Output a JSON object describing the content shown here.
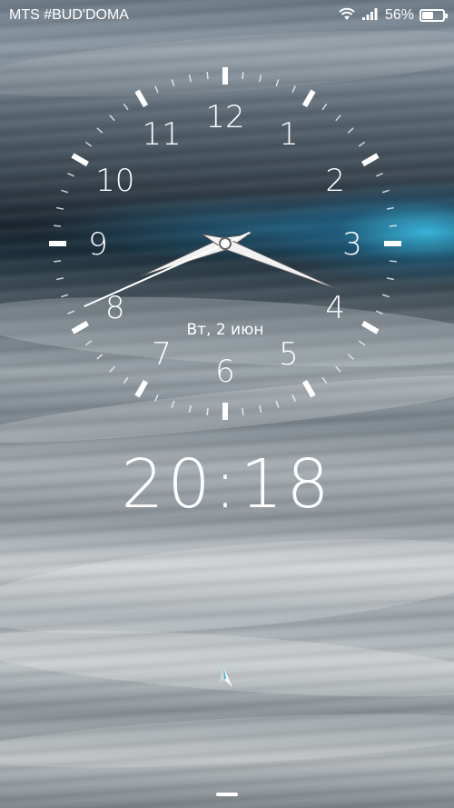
{
  "status_bar": {
    "carrier": "MTS #BUD'DOMA",
    "battery_percent": "56%",
    "battery_level": 0.56,
    "wifi_icon": "wifi-icon",
    "signal_icon": "signal-bars-icon"
  },
  "clock": {
    "numerals": [
      "12",
      "1",
      "2",
      "3",
      "4",
      "5",
      "6",
      "7",
      "8",
      "9",
      "10",
      "11"
    ],
    "date": "Вт, 2 июн",
    "hour": 20,
    "minute": 18,
    "second": 41
  },
  "digital_time": "20:18",
  "unlock_icon": "unlock-arrow-icon"
}
